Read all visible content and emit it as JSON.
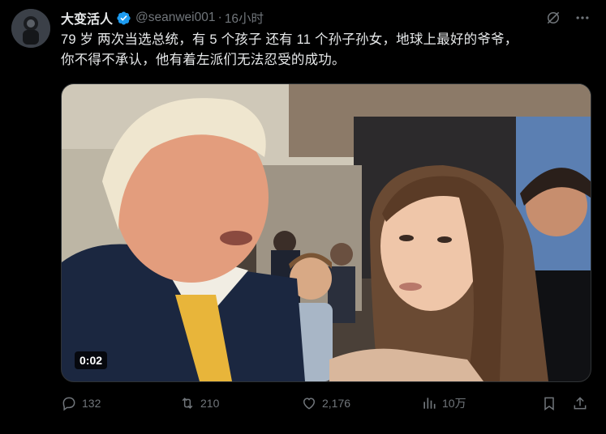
{
  "author": {
    "name": "大变活人",
    "handle": "@seanwei001",
    "separator": "·",
    "time": "16小时",
    "verified": true
  },
  "tweet": {
    "text_line1": "79 岁  两次当选总统，有 5 个孩子  还有 11 个孙子孙女，地球上最好的爷爷，",
    "text_line2": "你不得不承认，他有着左派们无法忍受的成功。"
  },
  "video": {
    "duration": "0:02"
  },
  "actions": {
    "replies": "132",
    "reposts": "210",
    "likes": "2,176",
    "views": "10万"
  },
  "icons": [
    "grok-icon",
    "more-icon",
    "verified-badge-icon",
    "reply-icon",
    "repost-icon",
    "like-icon",
    "views-icon",
    "bookmark-icon",
    "share-icon"
  ],
  "colors": {
    "background": "#000000",
    "text": "#e7e9ea",
    "muted": "#71767b",
    "verified": "#1d9bf0"
  }
}
